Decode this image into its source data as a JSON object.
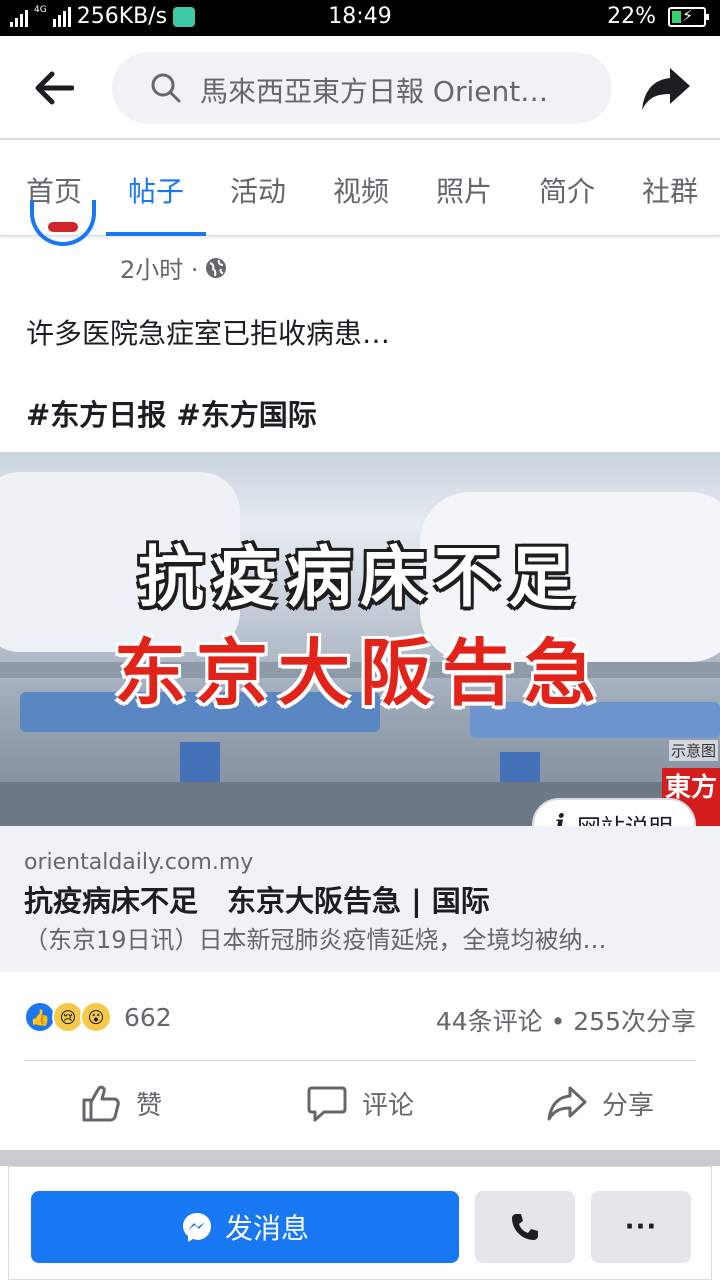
{
  "status_bar": {
    "speed": "256KB/s",
    "network": "4G",
    "time": "18:49",
    "battery": "22%"
  },
  "header": {
    "search_text": "馬來西亞東方日報 Orient…"
  },
  "tabs": [
    {
      "label": "首页",
      "active": false
    },
    {
      "label": "帖子",
      "active": true
    },
    {
      "label": "活动",
      "active": false
    },
    {
      "label": "视频",
      "active": false
    },
    {
      "label": "照片",
      "active": false
    },
    {
      "label": "简介",
      "active": false
    },
    {
      "label": "社群",
      "active": false
    }
  ],
  "post": {
    "time": "2小时 ·",
    "text": "许多医院急症室已拒收病患…",
    "hashtags": "#东方日报 #东方国际",
    "image": {
      "line1": "抗疫病床不足",
      "line2": "东京大阪告急",
      "note": "示意图",
      "logo": "東方"
    },
    "info_button": "网站说明",
    "link": {
      "domain": "orientaldaily.com.my",
      "title": "抗疫病床不足　东京大阪告急 | 国际",
      "description": "（东京19日讯）日本新冠肺炎疫情延烧，全境均被纳…"
    },
    "reactions_count": "662",
    "stats": "44条评论 • 255次分享",
    "actions": {
      "like": "赞",
      "comment": "评论",
      "share": "分享"
    }
  },
  "bottom_bar": {
    "message_button": "发消息",
    "more_button": "···"
  },
  "colors": {
    "accent": "#1877f2",
    "headline_red": "#e2231a"
  }
}
